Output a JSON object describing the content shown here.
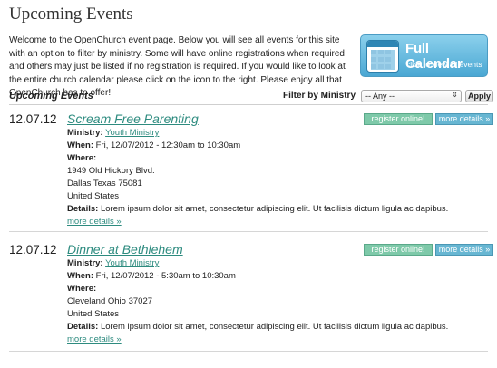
{
  "title": "Upcoming Events",
  "intro": "Welcome to the OpenChurch event page. Below you will see all events for this site with an option to filter by ministry. Some will have online registrations when required and others may just be listed if no registration is required. If you would like to look at the entire church calendar please click on the icon to the right. Please enjoy all that OpenChurch has to offer!",
  "calendar": {
    "title": "Full Calendar",
    "subtitle": "click to view all events",
    "icon": "calendar-icon"
  },
  "filter": {
    "section_title": "Upcoming Events",
    "label": "Filter by Ministry",
    "selected": "-- Any --",
    "apply": "Apply"
  },
  "labels": {
    "ministry": "Ministry:",
    "when": "When:",
    "where": "Where:",
    "details": "Details:",
    "register": "register online!",
    "more": "more details »",
    "more_link": "more details »"
  },
  "events": [
    {
      "date": "12.07.12",
      "name": "Scream Free Parenting",
      "ministry": "Youth Ministry",
      "when": "Fri, 12/07/2012 - 12:30am to 10:30am",
      "address1": "1949 Old Hickory Blvd.",
      "address2": "Dallas  Texas  75081",
      "country": "United States",
      "details": "Lorem ipsum dolor sit amet, consectetur adipiscing elit. Ut facilisis dictum ligula ac dapibus."
    },
    {
      "date": "12.07.12",
      "name": "Dinner at Bethlehem",
      "ministry": "Youth Ministry",
      "when": "Fri, 12/07/2012 - 5:30am to 10:30am",
      "address1": "Cleveland  Ohio  37027",
      "address2": "",
      "country": "United States",
      "details": "Lorem ipsum dolor sit amet, consectetur adipiscing elit. Ut facilisis dictum ligula ac dapibus."
    }
  ]
}
